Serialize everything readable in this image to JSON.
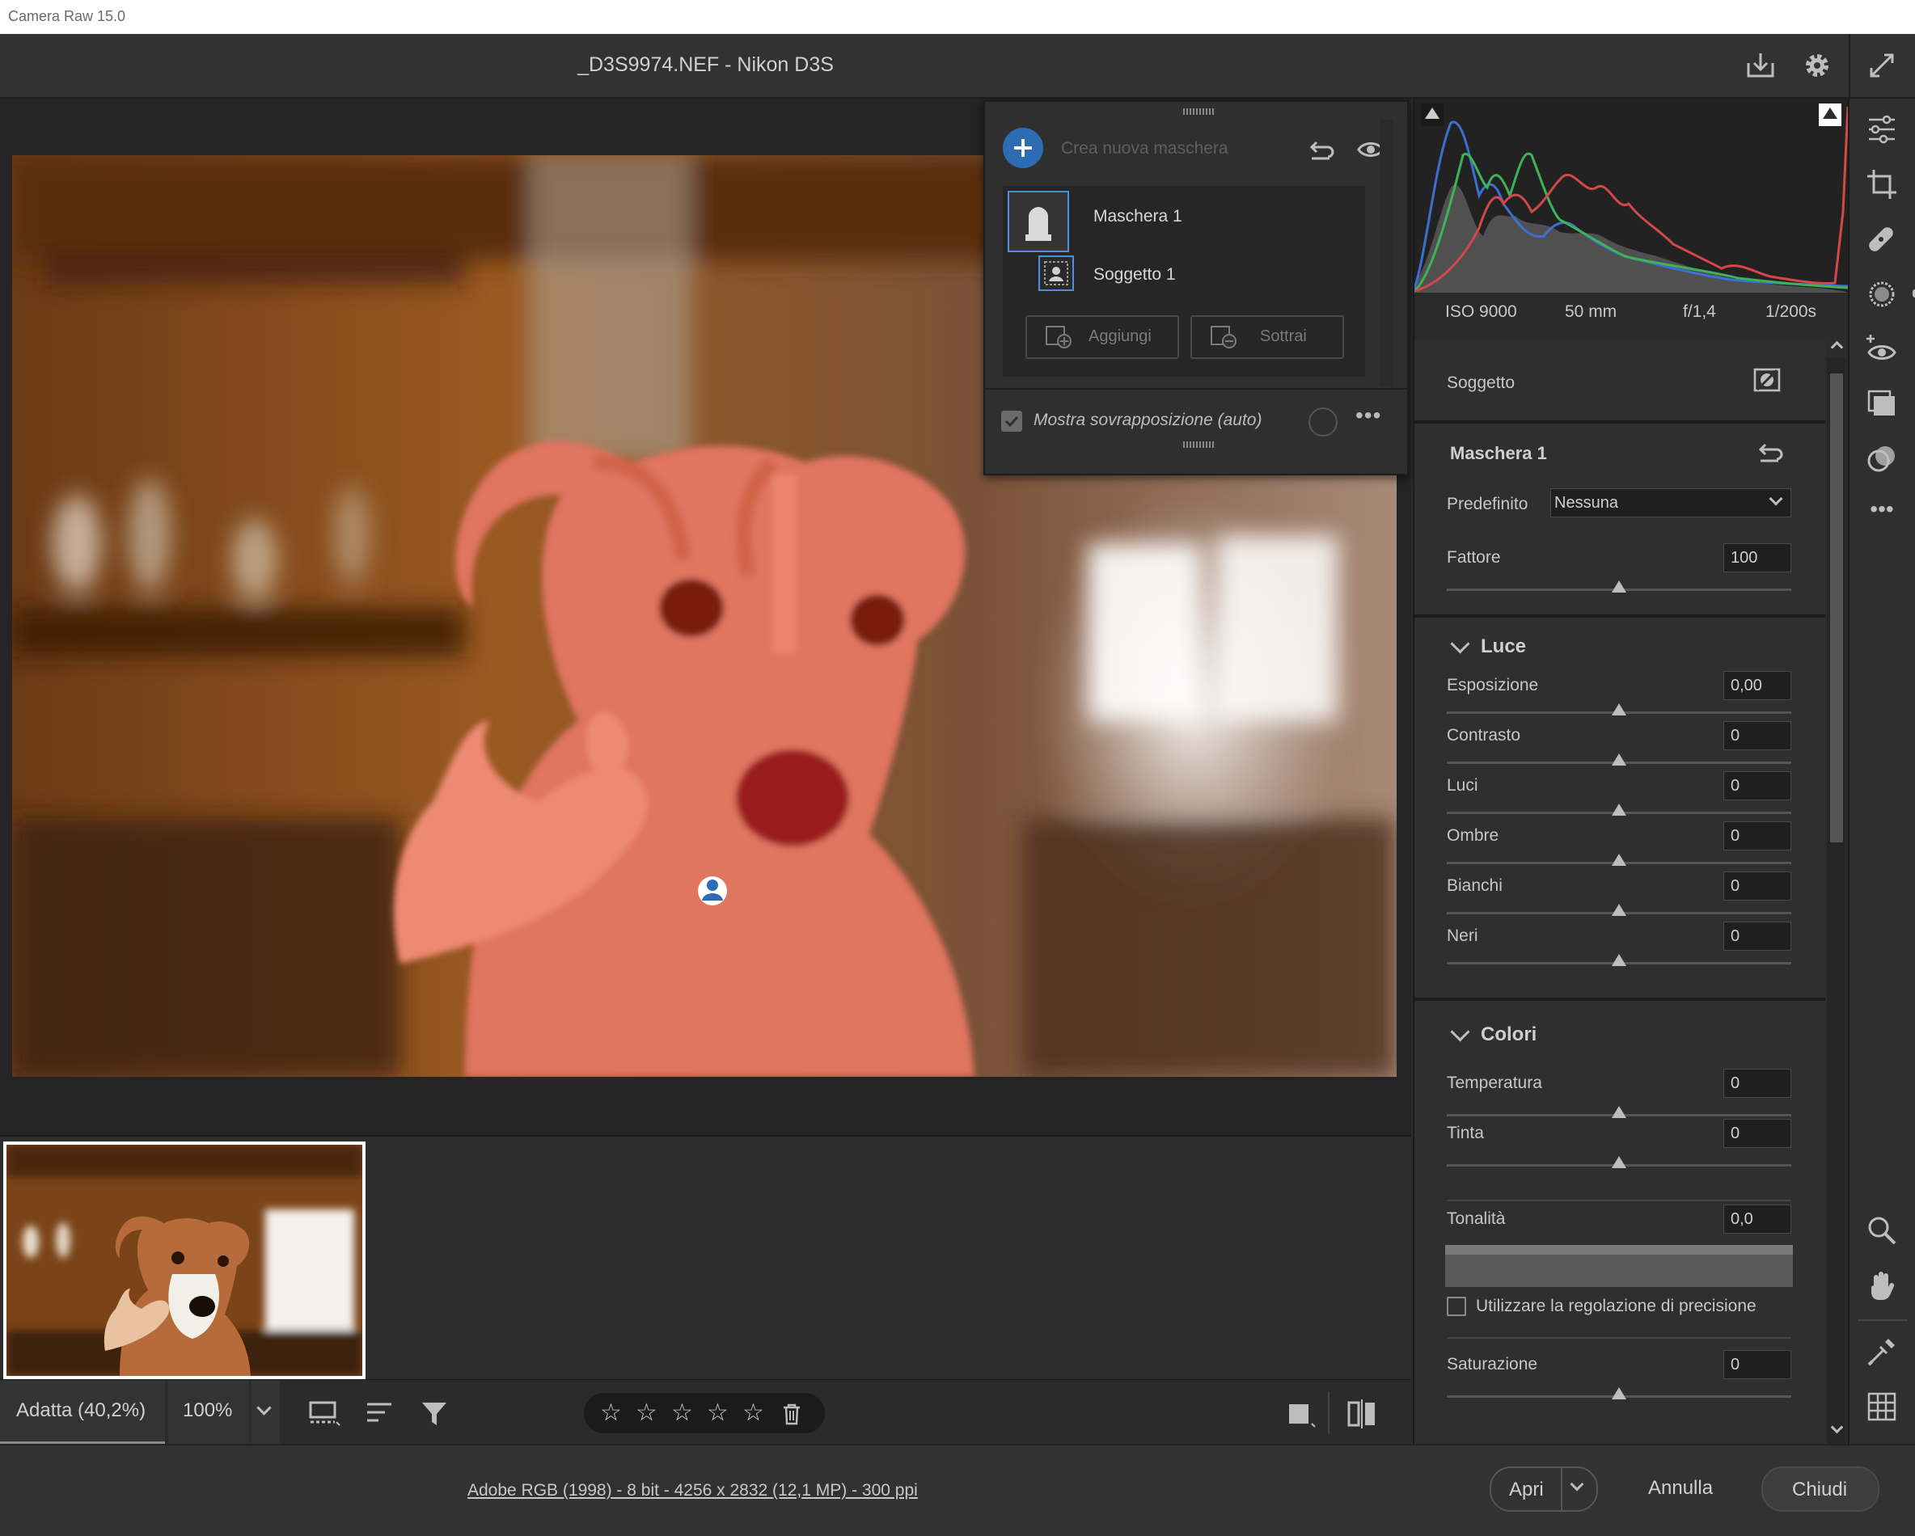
{
  "window": {
    "os_title": "Camera Raw 15.0"
  },
  "header": {
    "title": "_D3S9974.NEF  -  Nikon D3S"
  },
  "mask_panel": {
    "new_mask_placeholder": "Crea nuova maschera",
    "mask_name": "Maschera 1",
    "component_name": "Soggetto 1",
    "add_label": "Aggiungi",
    "subtract_label": "Sottrai",
    "overlay_label": "Mostra sovrapposizione (auto)",
    "more_label": "•••"
  },
  "exif": {
    "iso": "ISO 9000",
    "focal": "50 mm",
    "aperture": "f/1,4",
    "shutter": "1/200s"
  },
  "properties": {
    "subject_label": "Soggetto",
    "mask_title": "Maschera 1",
    "preset_label": "Predefinito",
    "preset_value": "Nessuna",
    "amount_label": "Fattore",
    "amount_value": "100",
    "light": {
      "title": "Luce",
      "sliders": [
        {
          "label": "Esposizione",
          "value": "0,00"
        },
        {
          "label": "Contrasto",
          "value": "0"
        },
        {
          "label": "Luci",
          "value": "0"
        },
        {
          "label": "Ombre",
          "value": "0"
        },
        {
          "label": "Bianchi",
          "value": "0"
        },
        {
          "label": "Neri",
          "value": "0"
        }
      ]
    },
    "color": {
      "title": "Colori",
      "temp_label": "Temperatura",
      "temp_value": "0",
      "tint_label": "Tinta",
      "tint_value": "0",
      "hue_label": "Tonalità",
      "hue_value": "0,0",
      "fine_label": "Utilizzare la regolazione di precisione",
      "sat_label": "Saturazione",
      "sat_value": "0"
    }
  },
  "toolbar": {
    "zoom_fit": "Adatta (40,2%)",
    "zoom_100": "100%",
    "stars": [
      "☆",
      "☆",
      "☆",
      "☆",
      "☆"
    ]
  },
  "status": {
    "file_info": "Adobe RGB (1998) - 8 bit - 4256 x 2832 (12,1 MP) - 300 ppi",
    "open_label": "Apri",
    "cancel_label": "Annulla",
    "close_label": "Chiudi"
  },
  "colors": {
    "accent": "#2e6bb5",
    "overlay": "#e06a55",
    "background": "#2b2b2b"
  }
}
